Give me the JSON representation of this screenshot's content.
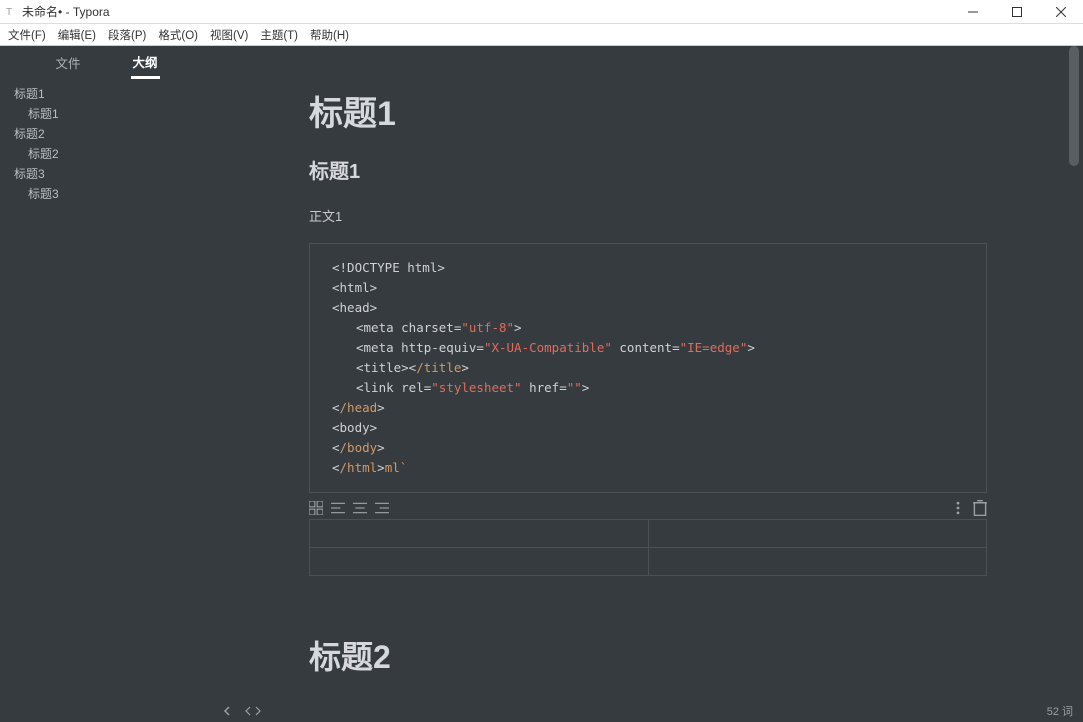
{
  "window": {
    "title": "未命名• - Typora"
  },
  "menu": {
    "file": "文件(F)",
    "edit": "编辑(E)",
    "paragraph": "段落(P)",
    "format": "格式(O)",
    "view": "视图(V)",
    "theme": "主题(T)",
    "help": "帮助(H)"
  },
  "sidebar": {
    "tab_files": "文件",
    "tab_outline": "大纲",
    "outline": [
      {
        "lvl": 1,
        "t": "标题1"
      },
      {
        "lvl": 2,
        "t": "标题1"
      },
      {
        "lvl": 1,
        "t": "标题2"
      },
      {
        "lvl": 2,
        "t": "标题2"
      },
      {
        "lvl": 1,
        "t": "标题3"
      },
      {
        "lvl": 2,
        "t": "标题3"
      }
    ]
  },
  "doc": {
    "h1": "标题1",
    "h2": "标题1",
    "p1": "正文1",
    "h1b": "标题2",
    "code": {
      "l0": "<!DOCTYPE html>",
      "l1": "<html>",
      "l2": "<head>",
      "l3a": "<meta charset=",
      "l3b": "\"utf-8\"",
      "l3c": ">",
      "l4a": "<meta http-equiv=",
      "l4b": "\"X-UA-Compatible\"",
      "l4c": " content=",
      "l4d": "\"IE=edge\"",
      "l4e": ">",
      "l5a": "<title><",
      "l5b": "/title",
      "l5c": ">",
      "l6a": "<link rel=",
      "l6b": "\"stylesheet\"",
      "l6c": " href=",
      "l6d": "\"\"",
      "l6e": ">",
      "l7a": "<",
      "l7b": "/head",
      "l7c": ">",
      "l8": "<body>",
      "l9": "",
      "l10a": "<",
      "l10b": "/body",
      "l10c": ">",
      "l11a": "<",
      "l11b": "/html",
      "l11c": ">",
      "l11d": "ml`"
    }
  },
  "status": {
    "word_count": "52 词"
  }
}
